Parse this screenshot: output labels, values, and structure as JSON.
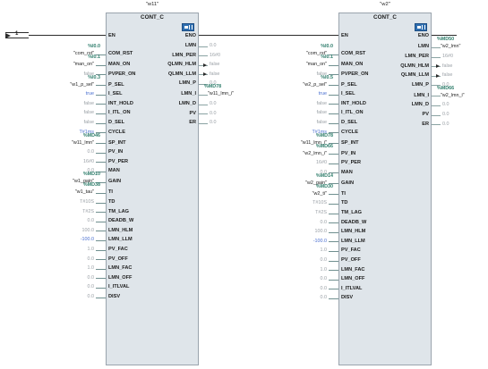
{
  "colors": {
    "address": "#2e7d6b",
    "blue_value": "#4a6fd0",
    "grey_value": "#9aa0a6",
    "block_fill": "#dfe5ea"
  },
  "connector": {
    "label": "1",
    "icon": "connector-arrow-icon"
  },
  "blocks": [
    {
      "instance": "\"w11\"",
      "type": "CONT_C",
      "icon": "function-block-icon",
      "en": "EN",
      "eno": "ENO",
      "inputs": [
        {
          "pin": "COM_RST",
          "addr": "%I0.0",
          "tag": "\"com_rst\"",
          "value": ""
        },
        {
          "pin": "MAN_ON",
          "addr": "%I0.1",
          "tag": "\"man_on\"",
          "value": ""
        },
        {
          "pin": "PVPER_ON",
          "addr": "",
          "tag": "",
          "value": "false"
        },
        {
          "pin": "P_SEL",
          "addr": "%I0.3",
          "tag": "\"w1_p_sel\"",
          "value": ""
        },
        {
          "pin": "I_SEL",
          "addr": "",
          "tag": "",
          "value": "true"
        },
        {
          "pin": "INT_HOLD",
          "addr": "",
          "tag": "",
          "value": "false"
        },
        {
          "pin": "I_ITL_ON",
          "addr": "",
          "tag": "",
          "value": "false"
        },
        {
          "pin": "D_SEL",
          "addr": "",
          "tag": "",
          "value": "false"
        },
        {
          "pin": "CYCLE",
          "addr": "",
          "tag": "",
          "value": "T#1ms"
        },
        {
          "pin": "SP_INT",
          "addr": "%MD46",
          "tag": "\"w11_lmn\"",
          "value": ""
        },
        {
          "pin": "PV_IN",
          "addr": "",
          "tag": "",
          "value": "0.0"
        },
        {
          "pin": "PV_PER",
          "addr": "",
          "tag": "",
          "value": "16#0"
        },
        {
          "pin": "MAN",
          "addr": "",
          "tag": "",
          "value": "0.0"
        },
        {
          "pin": "GAIN",
          "addr": "%MD10",
          "tag": "\"w1_gain\"",
          "value": ""
        },
        {
          "pin": "TI",
          "addr": "%MD38",
          "tag": "\"w1_tau\"",
          "value": ""
        },
        {
          "pin": "TD",
          "addr": "",
          "tag": "",
          "value": "T#10S"
        },
        {
          "pin": "TM_LAG",
          "addr": "",
          "tag": "",
          "value": "T#2S"
        },
        {
          "pin": "DEADB_W",
          "addr": "",
          "tag": "",
          "value": "0.0"
        },
        {
          "pin": "LMN_HLM",
          "addr": "",
          "tag": "",
          "value": "100.0"
        },
        {
          "pin": "LMN_LLM",
          "addr": "",
          "tag": "",
          "value": "-100.0"
        },
        {
          "pin": "PV_FAC",
          "addr": "",
          "tag": "",
          "value": "1.0"
        },
        {
          "pin": "PV_OFF",
          "addr": "",
          "tag": "",
          "value": "0.0"
        },
        {
          "pin": "LMN_FAC",
          "addr": "",
          "tag": "",
          "value": "1.0"
        },
        {
          "pin": "LMN_OFF",
          "addr": "",
          "tag": "",
          "value": "0.0"
        },
        {
          "pin": "I_ITLVAL",
          "addr": "",
          "tag": "",
          "value": "0.0"
        },
        {
          "pin": "DISV",
          "addr": "",
          "tag": "",
          "value": "0.0"
        }
      ],
      "outputs": [
        {
          "pin": "LMN",
          "addr": "",
          "tag": "",
          "value": "0.0"
        },
        {
          "pin": "LMN_PER",
          "addr": "",
          "tag": "",
          "value": "16#0"
        },
        {
          "pin": "QLMN_HLM",
          "addr": "",
          "tag": "",
          "value": "false"
        },
        {
          "pin": "QLMN_LLM",
          "addr": "",
          "tag": "",
          "value": "false"
        },
        {
          "pin": "LMN_P",
          "addr": "",
          "tag": "",
          "value": "0.0"
        },
        {
          "pin": "LMN_I",
          "addr": "%MD78",
          "tag": "\"w11_lmn_i\"",
          "value": ""
        },
        {
          "pin": "LMN_D",
          "addr": "",
          "tag": "",
          "value": "0.0"
        },
        {
          "pin": "PV",
          "addr": "",
          "tag": "",
          "value": "0.0"
        },
        {
          "pin": "ER",
          "addr": "",
          "tag": "",
          "value": "0.0"
        }
      ]
    },
    {
      "instance": "\"w2\"",
      "type": "CONT_C",
      "icon": "function-block-icon",
      "en": "EN",
      "eno": "ENO",
      "inputs": [
        {
          "pin": "COM_RST",
          "addr": "%I0.0",
          "tag": "\"com_rst\"",
          "value": ""
        },
        {
          "pin": "MAN_ON",
          "addr": "%I0.1",
          "tag": "\"man_on\"",
          "value": ""
        },
        {
          "pin": "PVPER_ON",
          "addr": "",
          "tag": "",
          "value": "false"
        },
        {
          "pin": "P_SEL",
          "addr": "%I0.5",
          "tag": "\"w2_p_sel\"",
          "value": ""
        },
        {
          "pin": "I_SEL",
          "addr": "",
          "tag": "",
          "value": "true"
        },
        {
          "pin": "INT_HOLD",
          "addr": "",
          "tag": "",
          "value": "false"
        },
        {
          "pin": "I_ITL_ON",
          "addr": "",
          "tag": "",
          "value": "false"
        },
        {
          "pin": "D_SEL",
          "addr": "",
          "tag": "",
          "value": "false"
        },
        {
          "pin": "CYCLE",
          "addr": "",
          "tag": "",
          "value": "T#1ms"
        },
        {
          "pin": "SP_INT",
          "addr": "%MD78",
          "tag": "\"w11_lmn_i\"",
          "value": ""
        },
        {
          "pin": "PV_IN",
          "addr": "%MD66",
          "tag": "\"w2_lmn_i\"",
          "value": ""
        },
        {
          "pin": "PV_PER",
          "addr": "",
          "tag": "",
          "value": "16#0"
        },
        {
          "pin": "MAN",
          "addr": "",
          "tag": "",
          "value": "0.0"
        },
        {
          "pin": "GAIN",
          "addr": "%MD14",
          "tag": "\"w2_gain\"",
          "value": ""
        },
        {
          "pin": "TI",
          "addr": "%MD30",
          "tag": "\"w2_ti\"",
          "value": ""
        },
        {
          "pin": "TD",
          "addr": "",
          "tag": "",
          "value": "T#10S"
        },
        {
          "pin": "TM_LAG",
          "addr": "",
          "tag": "",
          "value": "T#2S"
        },
        {
          "pin": "DEADB_W",
          "addr": "",
          "tag": "",
          "value": "0.0"
        },
        {
          "pin": "LMN_HLM",
          "addr": "",
          "tag": "",
          "value": "100.0"
        },
        {
          "pin": "LMN_LLM",
          "addr": "",
          "tag": "",
          "value": "-100.0"
        },
        {
          "pin": "PV_FAC",
          "addr": "",
          "tag": "",
          "value": "1.0"
        },
        {
          "pin": "PV_OFF",
          "addr": "",
          "tag": "",
          "value": "0.0"
        },
        {
          "pin": "LMN_FAC",
          "addr": "",
          "tag": "",
          "value": "1.0"
        },
        {
          "pin": "LMN_OFF",
          "addr": "",
          "tag": "",
          "value": "0.0"
        },
        {
          "pin": "I_ITLVAL",
          "addr": "",
          "tag": "",
          "value": "0.0"
        },
        {
          "pin": "DISV",
          "addr": "",
          "tag": "",
          "value": "0.0"
        }
      ],
      "outputs": [
        {
          "pin": "LMN",
          "addr": "%MD50",
          "tag": "\"w2_lmn\"",
          "value": ""
        },
        {
          "pin": "LMN_PER",
          "addr": "",
          "tag": "",
          "value": "16#0"
        },
        {
          "pin": "QLMN_HLM",
          "addr": "",
          "tag": "",
          "value": "false"
        },
        {
          "pin": "QLMN_LLM",
          "addr": "",
          "tag": "",
          "value": "false"
        },
        {
          "pin": "LMN_P",
          "addr": "",
          "tag": "",
          "value": "0.0"
        },
        {
          "pin": "LMN_I",
          "addr": "%MD66",
          "tag": "\"w2_lmn_i\"",
          "value": ""
        },
        {
          "pin": "LMN_D",
          "addr": "",
          "tag": "",
          "value": "0.0"
        },
        {
          "pin": "PV",
          "addr": "",
          "tag": "",
          "value": "0.0"
        },
        {
          "pin": "ER",
          "addr": "",
          "tag": "",
          "value": "0.0"
        }
      ]
    }
  ]
}
